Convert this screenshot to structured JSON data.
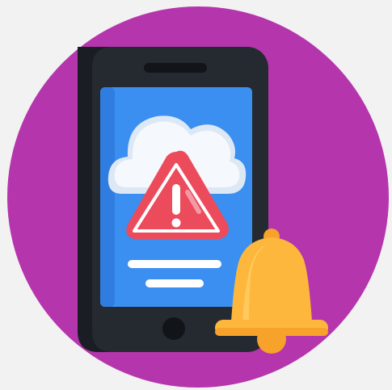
{
  "colors": {
    "background": "#f2f2f2",
    "circle": "#b535ad",
    "phone_body": "#252a31",
    "phone_shade": "#1a1e24",
    "screen": "#3a8ff0",
    "screen_shade": "#2f7de0",
    "cloud": "#f5f8fc",
    "cloud_shade": "#dde8f5",
    "alert_red": "#ec4b5b",
    "alert_red_dark": "#d63b4c",
    "alert_white": "#ffffff",
    "bell_yellow": "#fdb73d",
    "bell_orange": "#f7a22a",
    "side_button": "#6b7079",
    "text_line": "#ffffff"
  },
  "icons": {
    "illustration": "phone-alert-notification-icon",
    "phone": "smartphone-icon",
    "cloud": "cloud-icon",
    "warning": "warning-triangle-icon",
    "bell": "bell-icon"
  }
}
